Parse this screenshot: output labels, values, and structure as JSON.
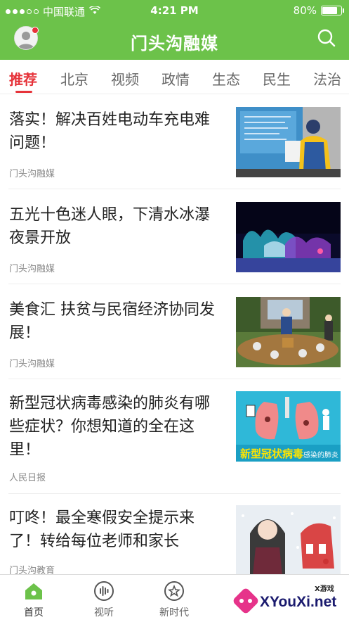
{
  "status_bar": {
    "carrier": "中国联通",
    "time": "4:21 PM",
    "battery": "80%",
    "battery_level": 0.8
  },
  "header": {
    "title": "门头沟融媒"
  },
  "tabs": [
    {
      "label": "推荐",
      "active": true
    },
    {
      "label": "北京"
    },
    {
      "label": "视频"
    },
    {
      "label": "政情"
    },
    {
      "label": "生态"
    },
    {
      "label": "民生"
    },
    {
      "label": "法治"
    }
  ],
  "articles": [
    {
      "title": "落实！解决百姓电动车充电难问题！",
      "source": "门头沟融媒",
      "thumb": "charging-station-photo"
    },
    {
      "title": "五光十色迷人眼，下清水冰瀑夜景开放",
      "source": "门头沟融媒",
      "thumb": "ice-waterfall-night-photo"
    },
    {
      "title": "美食汇 扶贫与民宿经济协同发展！",
      "source": "门头沟融媒",
      "thumb": "food-festival-photo"
    },
    {
      "title": "新型冠状病毒感染的肺炎有哪些症状？你想知道的全在这里！",
      "source": "人民日报",
      "thumb": "lung-illustration",
      "thumb_caption_big": "新型冠状病毒",
      "thumb_caption_small": "感染的肺炎"
    },
    {
      "title": "叮咚！最全寒假安全提示来了！转给每位老师和家长",
      "source": "门头沟教育",
      "thumb": "winter-illustration"
    }
  ],
  "bottom_nav": [
    {
      "label": "首页",
      "icon": "home-icon",
      "active": true
    },
    {
      "label": "视听",
      "icon": "audio-wave-icon"
    },
    {
      "label": "新时代",
      "icon": "star-badge-icon"
    }
  ],
  "watermark": {
    "small": "X游戏",
    "main": "XYouXi.net"
  },
  "colors": {
    "brand_green": "#6cc24a",
    "accent_red": "#e6333a"
  }
}
